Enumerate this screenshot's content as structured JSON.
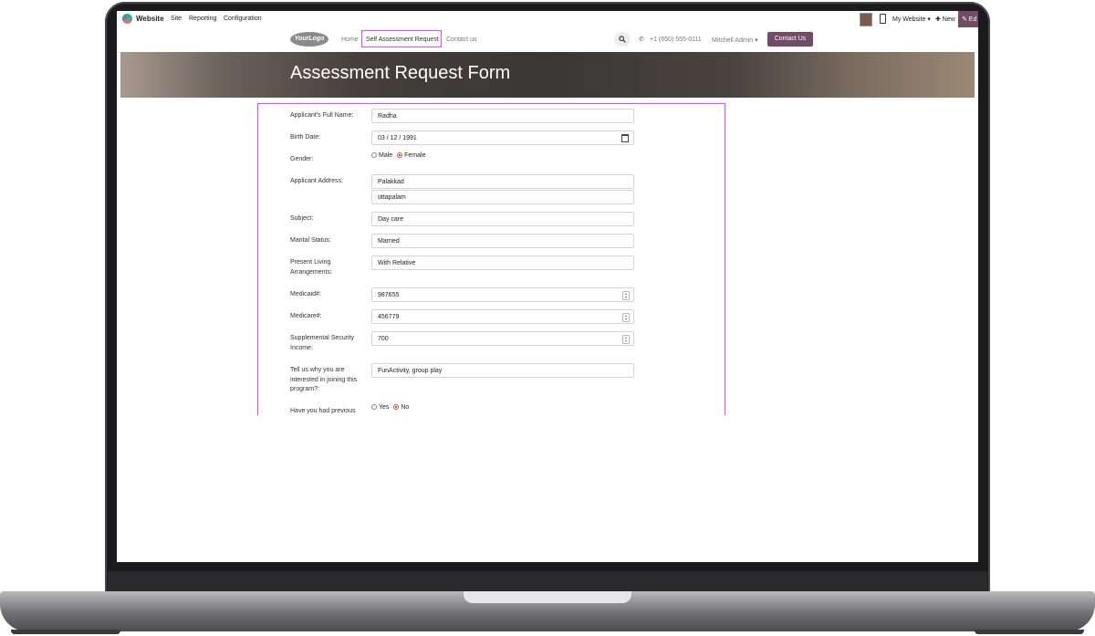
{
  "admin_bar": {
    "app_name": "Website",
    "menus": [
      "Site",
      "Reporting",
      "Configuration"
    ],
    "my_website": "My Website ▾",
    "new": "✚ New",
    "edit": "✎ Ed"
  },
  "site_nav": {
    "logo": "YourLogo",
    "links": [
      "Home",
      "Self Assessment Request",
      "Contact us"
    ],
    "phone": "+1 (650) 555-0111",
    "user": "Mitchell Admin ▾",
    "contact_button": "Contact Us"
  },
  "banner": {
    "title": "Assessment Request Form"
  },
  "form": {
    "full_name": {
      "label": "Applicant's Full Name:",
      "value": "Radha"
    },
    "birth_date": {
      "label": "Birth Date:",
      "value": "03 / 12 / 1991"
    },
    "gender": {
      "label": "Gender:",
      "options": [
        "Male",
        "Female"
      ],
      "selected": "Female"
    },
    "address": {
      "label": "Applicant Address:",
      "line1": "Palakkad",
      "line2": "ottapalam"
    },
    "subject": {
      "label": "Subject:",
      "value": "Day care"
    },
    "marital_status": {
      "label": "Marital Status:",
      "value": "Married"
    },
    "living": {
      "label": "Present Living Arrangements:",
      "value": "With Relative"
    },
    "medicaid": {
      "label": "Medicaid#:",
      "value": "987655"
    },
    "medicare": {
      "label": "Medicare#:",
      "value": "456779"
    },
    "ssi": {
      "label": "Supplemental Security Income:",
      "value": "700"
    },
    "reason": {
      "label": "Tell us why you are interested in joining this program?:",
      "value": "FunActivity, group play"
    },
    "previous": {
      "label": "Have you had previous",
      "options": [
        "Yes",
        "No"
      ],
      "selected": "No"
    }
  }
}
